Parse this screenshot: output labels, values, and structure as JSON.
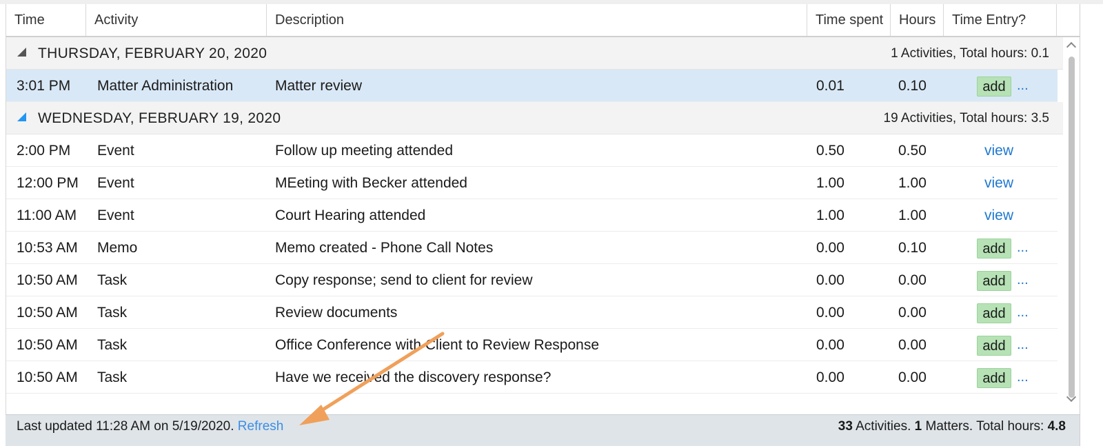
{
  "columns": {
    "time": "Time",
    "activity": "Activity",
    "description": "Description",
    "time_spent": "Time spent",
    "hours": "Hours",
    "time_entry": "Time Entry?"
  },
  "groups": [
    {
      "title": "THURSDAY, FEBRUARY 20, 2020",
      "summary": "1 Activities, Total hours: 0.1",
      "expanded": true,
      "rows": [
        {
          "time": "3:01 PM",
          "activity": "Matter Administration",
          "description": "Matter review",
          "time_spent": "0.01",
          "hours": "0.10",
          "action": "add",
          "more": "..."
        }
      ]
    },
    {
      "title": "WEDNESDAY, FEBRUARY 19, 2020",
      "summary": "19 Activities, Total hours: 3.5",
      "expanded": true,
      "rows": [
        {
          "time": "2:00 PM",
          "activity": "Event",
          "description": "Follow up meeting attended",
          "time_spent": "0.50",
          "hours": "0.50",
          "action": "view"
        },
        {
          "time": "12:00 PM",
          "activity": "Event",
          "description": "MEeting with Becker attended",
          "time_spent": "1.00",
          "hours": "1.00",
          "action": "view"
        },
        {
          "time": "11:00 AM",
          "activity": "Event",
          "description": "Court Hearing attended",
          "time_spent": "1.00",
          "hours": "1.00",
          "action": "view"
        },
        {
          "time": "10:53 AM",
          "activity": "Memo",
          "description": "Memo created - Phone Call Notes",
          "time_spent": "0.00",
          "hours": "0.10",
          "action": "add",
          "more": "..."
        },
        {
          "time": "10:50 AM",
          "activity": "Task",
          "description": "Copy response; send to client for review",
          "time_spent": "0.00",
          "hours": "0.00",
          "action": "add",
          "more": "..."
        },
        {
          "time": "10:50 AM",
          "activity": "Task",
          "description": "Review documents",
          "time_spent": "0.00",
          "hours": "0.00",
          "action": "add",
          "more": "..."
        },
        {
          "time": "10:50 AM",
          "activity": "Task",
          "description": "Office Conference with Client to Review Response",
          "time_spent": "0.00",
          "hours": "0.00",
          "action": "add",
          "more": "..."
        },
        {
          "time": "10:50 AM",
          "activity": "Task",
          "description": "Have we received the discovery response?",
          "time_spent": "0.00",
          "hours": "0.00",
          "action": "add",
          "more": "..."
        }
      ]
    }
  ],
  "status": {
    "last_updated": "Last updated 11:28 AM on 5/19/2020.",
    "refresh": "Refresh",
    "activities_count": "33",
    "activities_label": "Activities.",
    "matters_count": "1",
    "matters_label": "Matters. Total hours:",
    "total_hours": "4.8"
  },
  "colors": {
    "selected_row": "#d9e8f6",
    "add_button": "#b6e2b6",
    "link": "#1e78d0",
    "annotation_arrow": "#f0a05a",
    "statusbar": "#dfe4e8"
  },
  "icons": {
    "collapsed_toggle": "triangle-icon",
    "expanded_toggle": "triangle-icon",
    "scroll_up": "chevron-up-icon",
    "scroll_down": "chevron-down-icon",
    "annotation": "arrow-icon"
  }
}
